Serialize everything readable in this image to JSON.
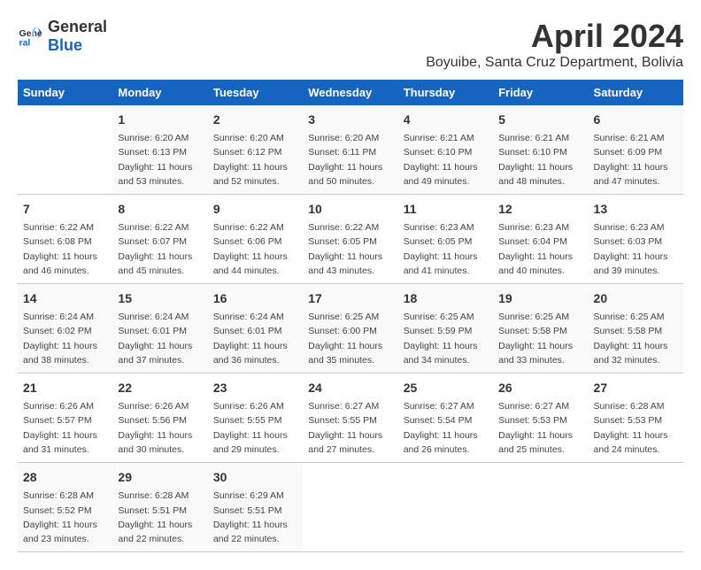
{
  "header": {
    "logo_general": "General",
    "logo_blue": "Blue",
    "month_title": "April 2024",
    "location": "Boyuibe, Santa Cruz Department, Bolivia"
  },
  "calendar": {
    "weekdays": [
      "Sunday",
      "Monday",
      "Tuesday",
      "Wednesday",
      "Thursday",
      "Friday",
      "Saturday"
    ],
    "weeks": [
      [
        {
          "day": "",
          "info": ""
        },
        {
          "day": "1",
          "info": "Sunrise: 6:20 AM\nSunset: 6:13 PM\nDaylight: 11 hours\nand 53 minutes."
        },
        {
          "day": "2",
          "info": "Sunrise: 6:20 AM\nSunset: 6:12 PM\nDaylight: 11 hours\nand 52 minutes."
        },
        {
          "day": "3",
          "info": "Sunrise: 6:20 AM\nSunset: 6:11 PM\nDaylight: 11 hours\nand 50 minutes."
        },
        {
          "day": "4",
          "info": "Sunrise: 6:21 AM\nSunset: 6:10 PM\nDaylight: 11 hours\nand 49 minutes."
        },
        {
          "day": "5",
          "info": "Sunrise: 6:21 AM\nSunset: 6:10 PM\nDaylight: 11 hours\nand 48 minutes."
        },
        {
          "day": "6",
          "info": "Sunrise: 6:21 AM\nSunset: 6:09 PM\nDaylight: 11 hours\nand 47 minutes."
        }
      ],
      [
        {
          "day": "7",
          "info": "Sunrise: 6:22 AM\nSunset: 6:08 PM\nDaylight: 11 hours\nand 46 minutes."
        },
        {
          "day": "8",
          "info": "Sunrise: 6:22 AM\nSunset: 6:07 PM\nDaylight: 11 hours\nand 45 minutes."
        },
        {
          "day": "9",
          "info": "Sunrise: 6:22 AM\nSunset: 6:06 PM\nDaylight: 11 hours\nand 44 minutes."
        },
        {
          "day": "10",
          "info": "Sunrise: 6:22 AM\nSunset: 6:05 PM\nDaylight: 11 hours\nand 43 minutes."
        },
        {
          "day": "11",
          "info": "Sunrise: 6:23 AM\nSunset: 6:05 PM\nDaylight: 11 hours\nand 41 minutes."
        },
        {
          "day": "12",
          "info": "Sunrise: 6:23 AM\nSunset: 6:04 PM\nDaylight: 11 hours\nand 40 minutes."
        },
        {
          "day": "13",
          "info": "Sunrise: 6:23 AM\nSunset: 6:03 PM\nDaylight: 11 hours\nand 39 minutes."
        }
      ],
      [
        {
          "day": "14",
          "info": "Sunrise: 6:24 AM\nSunset: 6:02 PM\nDaylight: 11 hours\nand 38 minutes."
        },
        {
          "day": "15",
          "info": "Sunrise: 6:24 AM\nSunset: 6:01 PM\nDaylight: 11 hours\nand 37 minutes."
        },
        {
          "day": "16",
          "info": "Sunrise: 6:24 AM\nSunset: 6:01 PM\nDaylight: 11 hours\nand 36 minutes."
        },
        {
          "day": "17",
          "info": "Sunrise: 6:25 AM\nSunset: 6:00 PM\nDaylight: 11 hours\nand 35 minutes."
        },
        {
          "day": "18",
          "info": "Sunrise: 6:25 AM\nSunset: 5:59 PM\nDaylight: 11 hours\nand 34 minutes."
        },
        {
          "day": "19",
          "info": "Sunrise: 6:25 AM\nSunset: 5:58 PM\nDaylight: 11 hours\nand 33 minutes."
        },
        {
          "day": "20",
          "info": "Sunrise: 6:25 AM\nSunset: 5:58 PM\nDaylight: 11 hours\nand 32 minutes."
        }
      ],
      [
        {
          "day": "21",
          "info": "Sunrise: 6:26 AM\nSunset: 5:57 PM\nDaylight: 11 hours\nand 31 minutes."
        },
        {
          "day": "22",
          "info": "Sunrise: 6:26 AM\nSunset: 5:56 PM\nDaylight: 11 hours\nand 30 minutes."
        },
        {
          "day": "23",
          "info": "Sunrise: 6:26 AM\nSunset: 5:55 PM\nDaylight: 11 hours\nand 29 minutes."
        },
        {
          "day": "24",
          "info": "Sunrise: 6:27 AM\nSunset: 5:55 PM\nDaylight: 11 hours\nand 27 minutes."
        },
        {
          "day": "25",
          "info": "Sunrise: 6:27 AM\nSunset: 5:54 PM\nDaylight: 11 hours\nand 26 minutes."
        },
        {
          "day": "26",
          "info": "Sunrise: 6:27 AM\nSunset: 5:53 PM\nDaylight: 11 hours\nand 25 minutes."
        },
        {
          "day": "27",
          "info": "Sunrise: 6:28 AM\nSunset: 5:53 PM\nDaylight: 11 hours\nand 24 minutes."
        }
      ],
      [
        {
          "day": "28",
          "info": "Sunrise: 6:28 AM\nSunset: 5:52 PM\nDaylight: 11 hours\nand 23 minutes."
        },
        {
          "day": "29",
          "info": "Sunrise: 6:28 AM\nSunset: 5:51 PM\nDaylight: 11 hours\nand 22 minutes."
        },
        {
          "day": "30",
          "info": "Sunrise: 6:29 AM\nSunset: 5:51 PM\nDaylight: 11 hours\nand 22 minutes."
        },
        {
          "day": "",
          "info": ""
        },
        {
          "day": "",
          "info": ""
        },
        {
          "day": "",
          "info": ""
        },
        {
          "day": "",
          "info": ""
        }
      ]
    ]
  }
}
